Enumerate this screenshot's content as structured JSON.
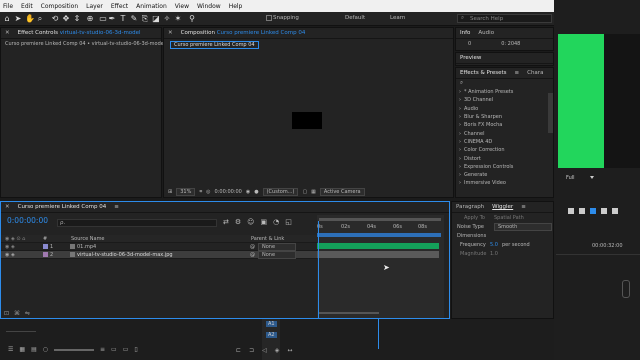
{
  "menu": [
    "File",
    "Edit",
    "Composition",
    "Layer",
    "Effect",
    "Animation",
    "View",
    "Window",
    "Help"
  ],
  "toolbar": {
    "snapping_label": "Snapping",
    "workspace_default": "Default",
    "workspace_learn": "Learn",
    "search_placeholder": "Search Help"
  },
  "effect_controls": {
    "tab_label": "Effect Controls",
    "tab_file": "virtual-tv-studio-06-3d-model",
    "breadcrumb": "Curso premiere Linked Comp 04 • virtual-tv-studio-06-3d-model"
  },
  "composition": {
    "tab_label": "Composition",
    "tab_name": "Curso premiere Linked Comp 04",
    "comp_tab": "Curso premiere Linked Comp 04",
    "zoom": "31%",
    "timecode": "0:00:00:00",
    "resolution": "(Custom...)",
    "camera": "Active Camera"
  },
  "info_panel": {
    "tab_info": "Info",
    "tab_audio": "Audio",
    "value_left": "0",
    "value_right": "0: 2048"
  },
  "preview_panel": {
    "tab": "Preview"
  },
  "effects_panel": {
    "tab": "Effects & Presets",
    "tab2": "Chara",
    "items": [
      "* Animation Presets",
      "3D Channel",
      "Audio",
      "Blur & Sharpen",
      "Boris FX Mocha",
      "Channel",
      "CINEMA 4D",
      "Color Correction",
      "Distort",
      "Expression Controls",
      "Generate",
      "Immersive Video"
    ]
  },
  "right_monitor": {
    "res_label": "Full"
  },
  "timeline": {
    "tab": "Curso premiere Linked Comp 04",
    "timecode": "0:00:00:00",
    "search_placeholder": "ρ.",
    "headers": {
      "num": "#",
      "source": "Source Name",
      "parent": "Parent & Link"
    },
    "rows": [
      {
        "num": "1",
        "name": "01.mp4",
        "parent": "None"
      },
      {
        "num": "2",
        "name": "virtual-tv-studio-06-3d-model-max.jpg",
        "parent": "None"
      }
    ],
    "ruler": [
      "0s",
      "02s",
      "04s",
      "06s",
      "08s"
    ]
  },
  "wiggler": {
    "tab_paragraph": "Paragraph",
    "tab_wiggler": "Wiggler",
    "apply_to": "Apply To",
    "apply_to_value": "Spatial Path",
    "noise_type": "Noise Type",
    "noise_value": "Smooth",
    "dimensions": "Dimensions",
    "frequency": "Frequency",
    "frequency_value": "5.0",
    "per_second": "per second",
    "magnitude": "Magnitude",
    "magnitude_value": "1.0"
  },
  "premiere_timeline": {
    "timecode": "00:00:32:00",
    "tracks": [
      "A1",
      "A2"
    ]
  },
  "colors": {
    "accent": "#2d8ceb",
    "green_screen": "#22d65c",
    "track_green": "#14a05a"
  }
}
